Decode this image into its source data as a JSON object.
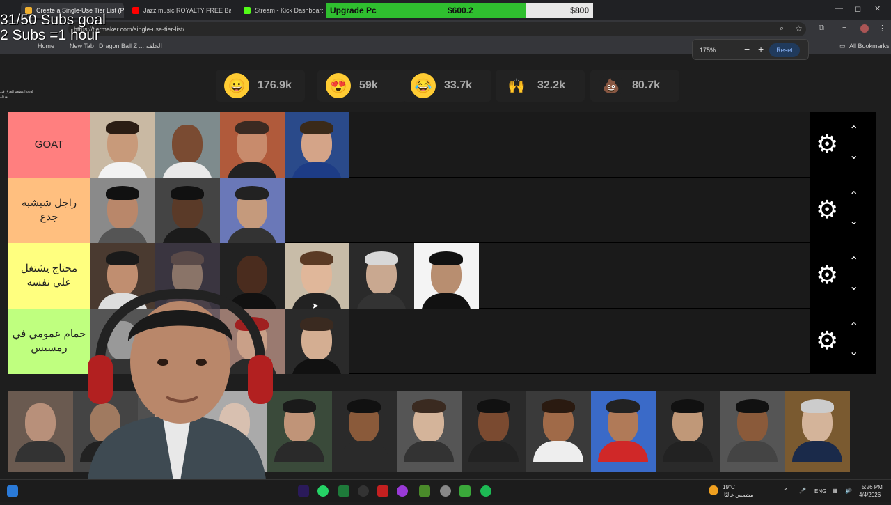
{
  "browser": {
    "tabs": [
      {
        "title": "Create a Single-Use Tier List (Pa",
        "color": "#f0b030",
        "active": true
      },
      {
        "title": "Jazz music ROYALTY FREE Backgr",
        "color": "#ff0000",
        "active": false
      },
      {
        "title": "Stream - Kick Dashboard",
        "color": "#53fc18",
        "active": false
      }
    ],
    "url": "https://tiermaker.com/single-use-tier-list/",
    "bookmarks": [
      "Home",
      "New Tab",
      "Dragon Ball Z ... الحلقة"
    ],
    "all_bookmarks": "All Bookmarks",
    "zoom": {
      "level": "175%",
      "minus": "−",
      "plus": "+",
      "reset": "Reset"
    },
    "window_controls": {
      "min": "—",
      "max": "◻",
      "close": "✕"
    }
  },
  "goal_bar": {
    "label": "Upgrade Pc",
    "current": "$600.2",
    "target": "$800",
    "progress": 0.75
  },
  "overlay": {
    "line1": "31/50 Subs goal",
    "line2": "2 Subs =1 hour"
  },
  "chat_mini": {
    "line1": "مطعم العرق في | goal",
    "line2": "+0 ••"
  },
  "reactions": [
    {
      "icon": "grinning-face-icon",
      "glyph": "😀",
      "count": "176.9k",
      "color": "#ffcc33"
    },
    {
      "icon": "heart-eyes-icon",
      "glyph": "😍",
      "count": "59k",
      "color": "#ffcc33"
    },
    {
      "icon": "tears-of-joy-icon",
      "glyph": "😂",
      "count": "33.7k",
      "color": "#ffcc33"
    },
    {
      "icon": "raised-hands-icon",
      "glyph": "🙌",
      "count": "32.2k",
      "color": "#222222"
    },
    {
      "icon": "poop-icon",
      "glyph": "💩",
      "count": "80.7k",
      "color": "#222222"
    }
  ],
  "tiers": [
    {
      "label": "GOAT",
      "color": "#ff7f7f",
      "items": 4
    },
    {
      "label": "راجل شبشبه جدع",
      "color": "#ffbf7f",
      "items": 3
    },
    {
      "label": "محتاج يشتغل علي نفسه",
      "color": "#ffff7f",
      "items": 6
    },
    {
      "label": "حمام عمومي في رمسيس",
      "color": "#bfff7f",
      "items": 5
    }
  ],
  "tier_controls": {
    "gear": "⚙",
    "up": "⌃",
    "down": "⌄"
  },
  "taskbar": {
    "weather_temp": "19°C",
    "weather_desc": "مشمس غالبًا",
    "lang": "ENG",
    "time": "5:26 PM",
    "date": "4/4/2026"
  }
}
